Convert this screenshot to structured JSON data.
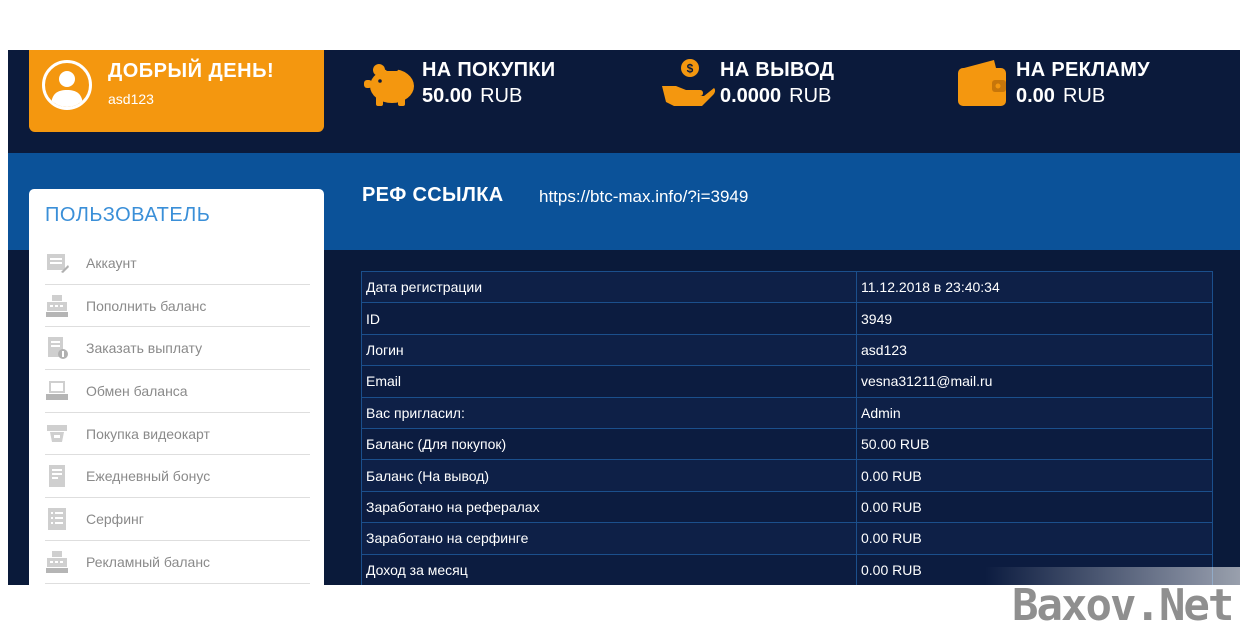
{
  "greeting": {
    "title": "ДОБРЫЙ ДЕНЬ!",
    "username": "asd123",
    "avatar_icon": "user-avatar-icon",
    "color": "#f4970f"
  },
  "stats": [
    {
      "title": "НА ПОКУПКИ",
      "amount": "50.00",
      "currency": "RUB",
      "icon": "piggy-bank-icon"
    },
    {
      "title": "НА ВЫВОД",
      "amount": "0.0000",
      "currency": "RUB",
      "icon": "hand-coin-icon"
    },
    {
      "title": "НА РЕКЛАМУ",
      "amount": "0.00",
      "currency": "RUB",
      "icon": "wallet-icon"
    }
  ],
  "referral": {
    "title": "РЕФ ССЫЛКА",
    "link": "https://btc-max.info/?i=3949"
  },
  "sidebar": {
    "title": "ПОЛЬЗОВАТЕЛЬ",
    "items": [
      {
        "label": "Аккаунт",
        "icon": "account-icon"
      },
      {
        "label": "Пополнить баланс",
        "icon": "cash-register-icon"
      },
      {
        "label": "Заказать выплату",
        "icon": "payout-document-icon"
      },
      {
        "label": "Обмен баланса",
        "icon": "exchange-icon"
      },
      {
        "label": "Покупка видеокарт",
        "icon": "video-card-icon"
      },
      {
        "label": "Ежедневный бонус",
        "icon": "bonus-icon"
      },
      {
        "label": "Серфинг",
        "icon": "surfing-list-icon"
      },
      {
        "label": "Рекламный баланс",
        "icon": "ad-balance-icon"
      }
    ]
  },
  "profile": {
    "rows": [
      {
        "label": "Дата регистрации",
        "value": "11.12.2018 в 23:40:34"
      },
      {
        "label": "ID",
        "value": "3949"
      },
      {
        "label": "Логин",
        "value": "asd123"
      },
      {
        "label": "Email",
        "value": "vesna31211@mail.ru"
      },
      {
        "label": "Вас пригласил:",
        "value": "Admin"
      },
      {
        "label": "Баланс (Для покупок)",
        "value": "50.00 RUB"
      },
      {
        "label": "Баланс (На вывод)",
        "value": "0.00 RUB"
      },
      {
        "label": "Заработано на рефералах",
        "value": "0.00 RUB"
      },
      {
        "label": "Заработано на серфинге",
        "value": "0.00 RUB"
      },
      {
        "label": "Доход за месяц",
        "value": "0.00 RUB"
      }
    ]
  },
  "watermark": "Baxov.Net",
  "colors": {
    "accent": "#f4970f",
    "header_bg": "#0b1a3b",
    "band_bg": "#0b5299",
    "sidebar_title": "#3a8fd8"
  }
}
